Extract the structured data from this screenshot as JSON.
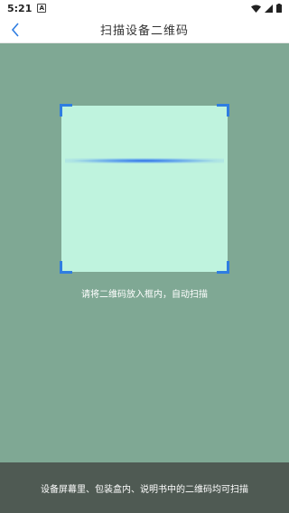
{
  "status_bar": {
    "time": "5:21",
    "notification_badge": "A",
    "icons": [
      "wifi-icon",
      "signal-icon",
      "battery-icon"
    ]
  },
  "header": {
    "title": "扫描设备二维码",
    "back_icon": "chevron-left-icon"
  },
  "scanner": {
    "hint": "请将二维码放入框内，自动扫描",
    "frame_color": "#bff3de",
    "corner_color": "#2f7de1"
  },
  "footer": {
    "text": "设备屏幕里、包装盒内、说明书中的二维码均可扫描"
  },
  "colors": {
    "background": "#7fa894",
    "footer_bg": "#4f5a53",
    "accent": "#2f7de1"
  }
}
